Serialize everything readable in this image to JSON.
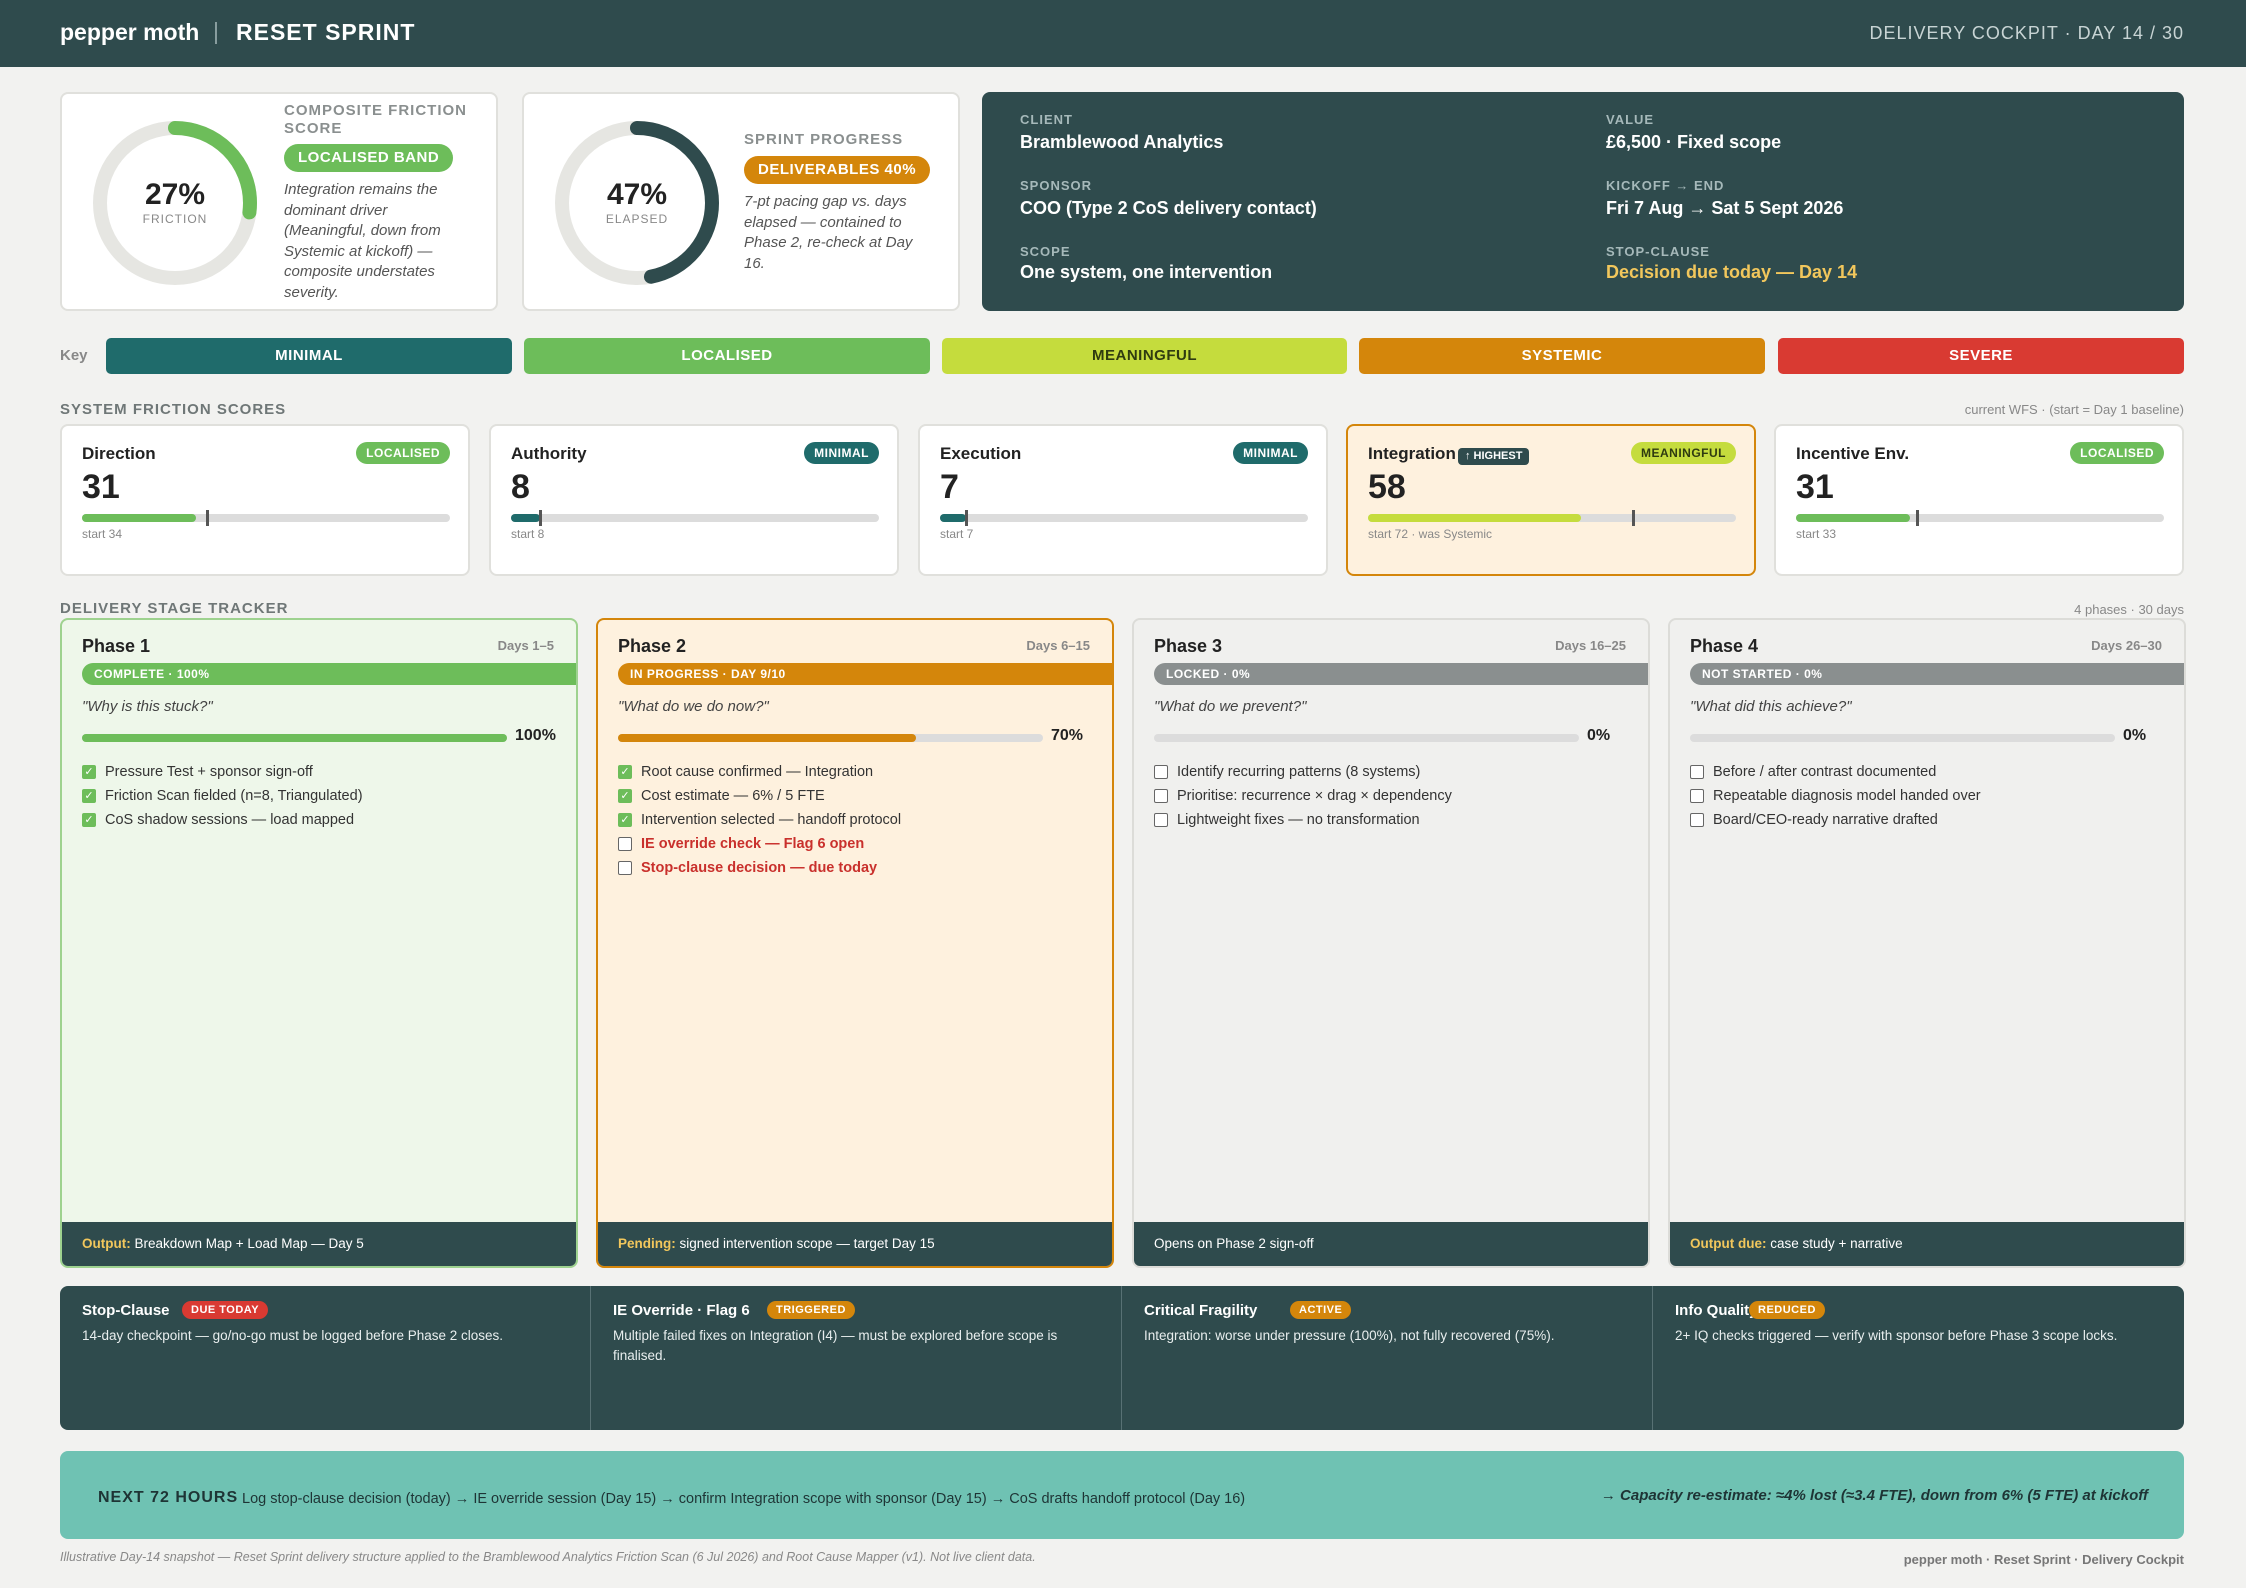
{
  "header": {
    "brand": "pepper moth",
    "separator": "|",
    "sprint": "RESET SPRINT",
    "cockpit": "DELIVERY COCKPIT · DAY 14 / 30"
  },
  "colors": {
    "dark_teal": "#2f4b4d",
    "minimal": "#1f6b6b",
    "localised": "#6dbd5a",
    "meaningful": "#c5dc3d",
    "systemic": "#d4860b",
    "severe": "#d93a32",
    "gold": "#f2c75c"
  },
  "friction_gauge": {
    "value": 27,
    "pct": "27%",
    "sub": "FRICTION",
    "title": "COMPOSITE FRICTION SCORE",
    "badge": "LOCALISED BAND",
    "note": "Integration remains the dominant driver (Meaningful, down from Systemic at kickoff) — composite understates severity."
  },
  "progress_gauge": {
    "value": 47,
    "pct": "47%",
    "sub": "ELAPSED",
    "title": "SPRINT PROGRESS",
    "badge": "DELIVERABLES 40%",
    "note": "7-pt pacing gap vs. days elapsed — contained to Phase 2, re-check at Day 16."
  },
  "client_info": {
    "client_label": "CLIENT",
    "client": "Bramblewood Analytics",
    "value_label": "VALUE",
    "value": "£6,500 · Fixed scope",
    "sponsor_label": "SPONSOR",
    "sponsor": "COO (Type 2 CoS delivery contact)",
    "dates_label": "KICKOFF → END",
    "dates": "Fri 7 Aug → Sat 5 Sept 2026",
    "scope_label": "SCOPE",
    "scope": "One system, one intervention",
    "stop_label": "STOP-CLAUSE",
    "stop": "Decision due today — Day 14"
  },
  "key": {
    "label": "Key",
    "items": [
      "MINIMAL",
      "LOCALISED",
      "MEANINGFUL",
      "SYSTEMIC",
      "SEVERE"
    ]
  },
  "systems": {
    "title": "SYSTEM FRICTION SCORES",
    "meta": "current WFS · (start = Day 1 baseline)",
    "highest_tag": "↑ HIGHEST",
    "items": [
      {
        "name": "Direction",
        "badge": "LOCALISED",
        "score": "31",
        "current": 31,
        "start": 34,
        "start_label": "start 34"
      },
      {
        "name": "Authority",
        "badge": "MINIMAL",
        "score": "8",
        "current": 8,
        "start": 8,
        "start_label": "start 8"
      },
      {
        "name": "Execution",
        "badge": "MINIMAL",
        "score": "7",
        "current": 7,
        "start": 7,
        "start_label": "start 7"
      },
      {
        "name": "Integration",
        "badge": "MEANINGFUL",
        "score": "58",
        "current": 58,
        "start": 72,
        "start_label": "start 72 · was Systemic"
      },
      {
        "name": "Incentive Env.",
        "badge": "LOCALISED",
        "score": "31",
        "current": 31,
        "start": 33,
        "start_label": "start 33"
      }
    ]
  },
  "stages": {
    "title": "DELIVERY STAGE TRACKER",
    "meta": "4 phases · 30 days",
    "phases": [
      {
        "title": "Phase 1",
        "days": "Days 1–5",
        "status": "COMPLETE · 100%",
        "question": "\"Why is this stuck?\"",
        "progress": 100,
        "pct": "100%",
        "items": [
          {
            "text": "Pressure Test + sponsor sign-off",
            "done": true
          },
          {
            "text": "Friction Scan fielded (n=8, Triangulated)",
            "done": true
          },
          {
            "text": "CoS shadow sessions — load mapped",
            "done": true
          }
        ],
        "foot_label": "Output:",
        "foot_text": "Breakdown Map + Load Map — Day 5"
      },
      {
        "title": "Phase 2",
        "days": "Days 6–15",
        "status": "IN PROGRESS · DAY 9/10",
        "question": "\"What do we do now?\"",
        "progress": 70,
        "pct": "70%",
        "items": [
          {
            "text": "Root cause confirmed — Integration",
            "done": true
          },
          {
            "text": "Cost estimate — 6% / 5 FTE",
            "done": true
          },
          {
            "text": "Intervention selected — handoff protocol",
            "done": true
          },
          {
            "text": "IE override check — Flag 6 open",
            "done": false,
            "alert": true
          },
          {
            "text": "Stop-clause decision — due today",
            "done": false,
            "alert": true
          }
        ],
        "foot_label": "Pending:",
        "foot_text": "signed intervention scope — target Day 15"
      },
      {
        "title": "Phase 3",
        "days": "Days 16–25",
        "status": "LOCKED · 0%",
        "question": "\"What do we prevent?\"",
        "progress": 0,
        "pct": "0%",
        "items": [
          {
            "text": "Identify recurring patterns (8 systems)",
            "done": false
          },
          {
            "text": "Prioritise: recurrence × drag × dependency",
            "done": false
          },
          {
            "text": "Lightweight fixes — no transformation",
            "done": false
          }
        ],
        "foot_label": "",
        "foot_text": "Opens on Phase 2 sign-off"
      },
      {
        "title": "Phase 4",
        "days": "Days 26–30",
        "status": "NOT STARTED · 0%",
        "question": "\"What did this achieve?\"",
        "progress": 0,
        "pct": "0%",
        "items": [
          {
            "text": "Before / after contrast documented",
            "done": false
          },
          {
            "text": "Repeatable diagnosis model handed over",
            "done": false
          },
          {
            "text": "Board/CEO-ready narrative drafted",
            "done": false
          }
        ],
        "foot_label": "Output due:",
        "foot_text": "case study + narrative"
      }
    ]
  },
  "flags": [
    {
      "title": "Stop-Clause",
      "badge": "DUE TODAY",
      "desc": "14-day checkpoint — go/no-go must be logged before Phase 2 closes."
    },
    {
      "title": "IE Override · Flag 6",
      "badge": "TRIGGERED",
      "desc": "Multiple failed fixes on Integration (I4) — must be explored before scope is finalised."
    },
    {
      "title": "Critical Fragility",
      "badge": "ACTIVE",
      "desc": "Integration: worse under pressure (100%), not fully recovered (75%)."
    },
    {
      "title": "Info Quality",
      "badge": "REDUCED",
      "desc": "2+ IQ checks triggered — verify with sponsor before Phase 3 scope locks."
    }
  ],
  "next72": {
    "label": "NEXT 72 HOURS",
    "text": "Log stop-clause decision (today) → IE override session (Day 15) → confirm Integration scope with sponsor (Day 15) → CoS drafts handoff protocol (Day 16)",
    "right": "→ Capacity re-estimate: ≈4% lost (≈3.4 FTE), down from 6% (5 FTE) at kickoff"
  },
  "footer": {
    "left": "Illustrative Day-14 snapshot — Reset Sprint delivery structure applied to the Bramblewood Analytics Friction Scan (6 Jul 2026) and Root Cause Mapper (v1). Not live client data.",
    "right": "pepper moth · Reset Sprint · Delivery Cockpit"
  }
}
